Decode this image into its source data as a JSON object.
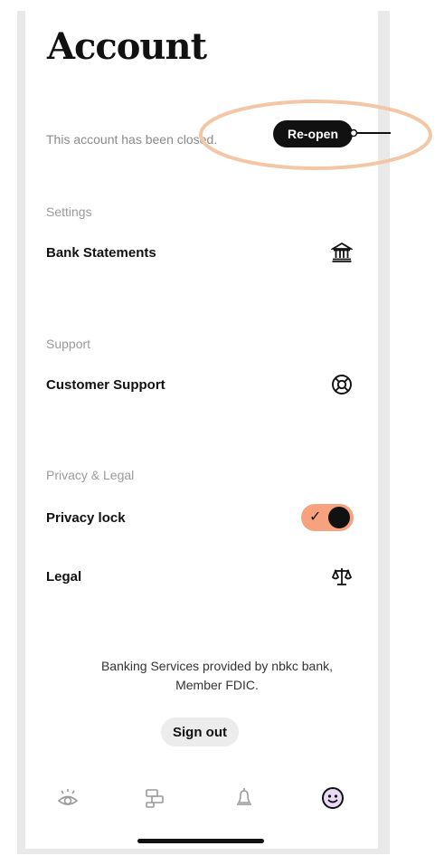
{
  "page": {
    "title": "Account"
  },
  "account_status": {
    "message": "This account has been closed.",
    "reopen_label": "Re-open"
  },
  "sections": [
    {
      "header": "Settings",
      "rows": [
        {
          "label": "Bank Statements",
          "icon": "bank-icon"
        }
      ]
    },
    {
      "header": "Support",
      "rows": [
        {
          "label": "Customer Support",
          "icon": "lifebuoy-icon"
        }
      ]
    },
    {
      "header": "Privacy & Legal",
      "rows": [
        {
          "label": "Privacy lock",
          "control": "toggle",
          "enabled": true
        },
        {
          "label": "Legal",
          "icon": "scales-icon"
        }
      ]
    }
  ],
  "footer": {
    "disclosure_line1": "Banking Services provided by nbkc bank,",
    "disclosure_line2": "Member FDIC.",
    "signout_label": "Sign out"
  },
  "tabbar": {
    "items": [
      {
        "icon": "eye-icon",
        "active": false
      },
      {
        "icon": "accounts-icon",
        "active": false
      },
      {
        "icon": "bell-icon",
        "active": false
      },
      {
        "icon": "smiley-icon",
        "active": true
      }
    ]
  },
  "colors": {
    "accent": "#f6a27f",
    "annotation": "#f3c7a6",
    "text": "#111111",
    "muted": "#9a9a9a"
  }
}
